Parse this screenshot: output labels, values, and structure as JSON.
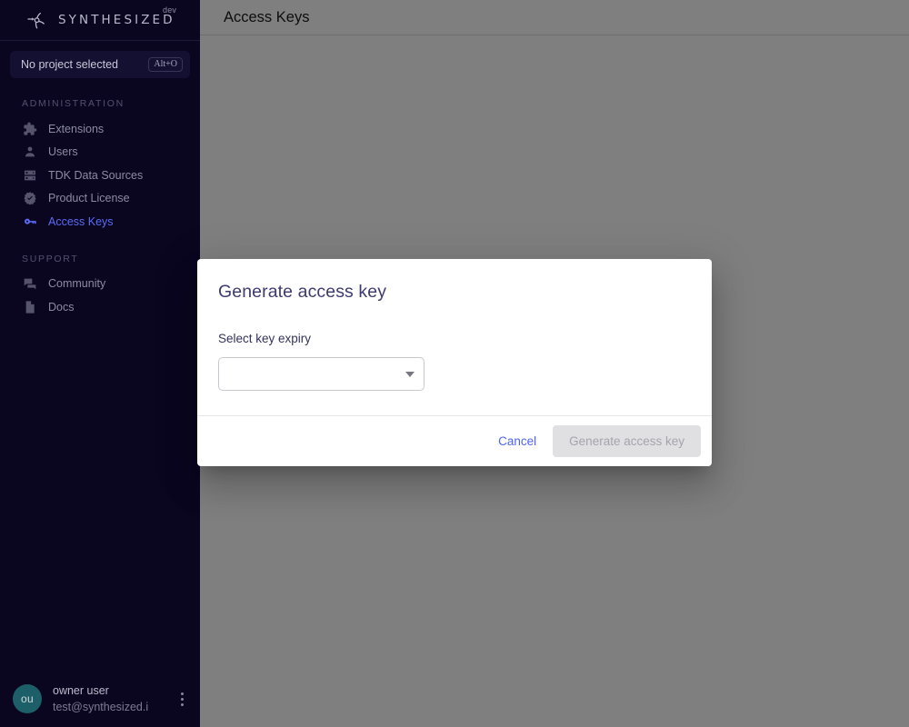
{
  "brand": {
    "name": "SYNTHESIZED",
    "superscript": "dev",
    "logo_icon": "synthesized-logo-icon"
  },
  "sidebar": {
    "project_selector": {
      "label": "No project selected",
      "shortcut": "Alt+O"
    },
    "sections": [
      {
        "heading": "ADMINISTRATION",
        "items": [
          {
            "label": "Extensions",
            "icon": "puzzle-piece-icon",
            "active": false
          },
          {
            "label": "Users",
            "icon": "person-icon",
            "active": false
          },
          {
            "label": "TDK Data Sources",
            "icon": "database-icon",
            "active": false
          },
          {
            "label": "Product License",
            "icon": "verified-badge-icon",
            "active": false
          },
          {
            "label": "Access Keys",
            "icon": "key-icon",
            "active": true
          }
        ]
      },
      {
        "heading": "SUPPORT",
        "items": [
          {
            "label": "Community",
            "icon": "chat-bubble-icon",
            "active": false
          },
          {
            "label": "Docs",
            "icon": "document-icon",
            "active": false
          }
        ]
      }
    ],
    "user": {
      "initials": "ou",
      "name": "owner user",
      "email": "test@synthesized.i",
      "menu_icon": "kebab-menu-icon"
    }
  },
  "header": {
    "title": "Access Keys"
  },
  "dialog": {
    "title": "Generate access key",
    "field_label": "Select key expiry",
    "select": {
      "value": "",
      "placeholder": "",
      "arrow_icon": "chevron-down-icon"
    },
    "cancel_label": "Cancel",
    "submit_label": "Generate access key",
    "submit_disabled": true
  },
  "colors": {
    "sidebar_bg": "#0a0620",
    "accent_blue": "#5b6cf5",
    "link_blue": "#4f63f0",
    "avatar_bg": "#1c5f68",
    "dialog_title": "#3c3b70",
    "scrim": "rgba(0,0,0,0.5)"
  }
}
